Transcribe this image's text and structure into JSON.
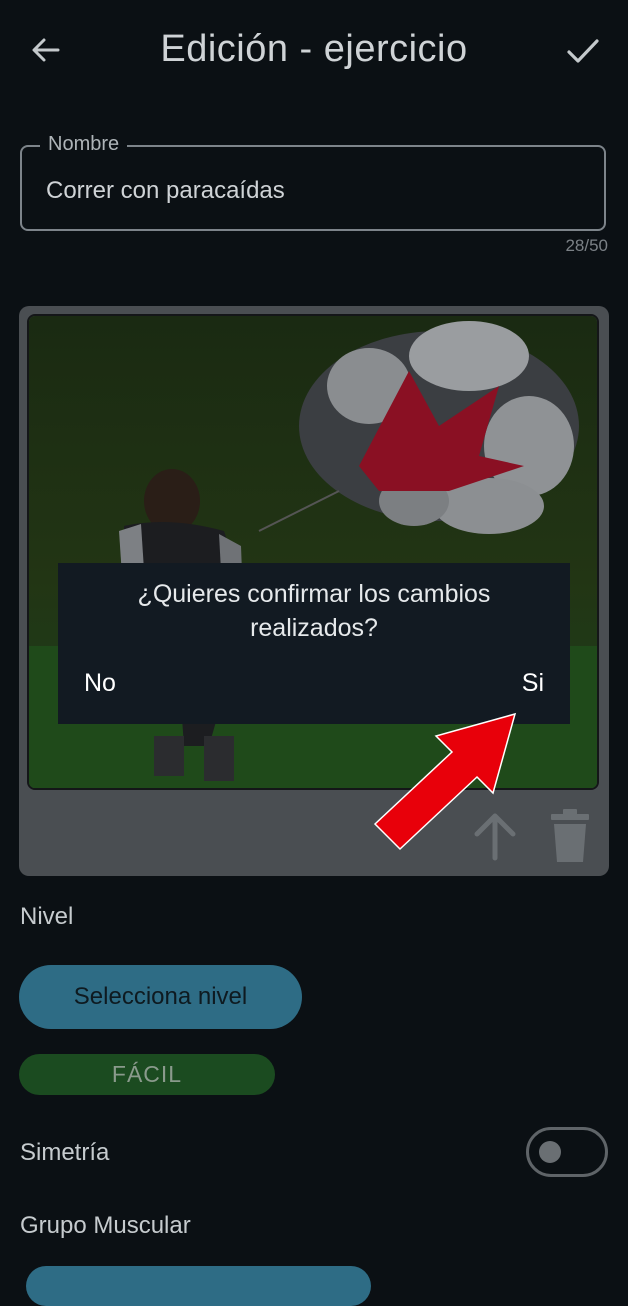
{
  "header": {
    "title": "Edición - ejercicio",
    "back_icon": "arrow-left-icon",
    "confirm_icon": "check-icon"
  },
  "name_field": {
    "label": "Nombre",
    "value": "Correr con paracaídas",
    "counter": "28/50"
  },
  "image_card": {
    "upload_icon": "arrow-up-icon",
    "delete_icon": "trash-icon"
  },
  "level": {
    "label": "Nivel",
    "select_button": "Selecciona nivel",
    "selected_level": "FÁCIL"
  },
  "symmetry": {
    "label": "Simetría",
    "enabled": false
  },
  "muscle_group": {
    "label": "Grupo Muscular"
  },
  "dialog": {
    "message": "¿Quieres confirmar los cambios realizados?",
    "no_label": "No",
    "yes_label": "Si"
  },
  "colors": {
    "background": "#0b1014",
    "accent": "#2e6c85",
    "level_easy": "#1b4b20",
    "annotation_arrow": "#e8000a"
  }
}
